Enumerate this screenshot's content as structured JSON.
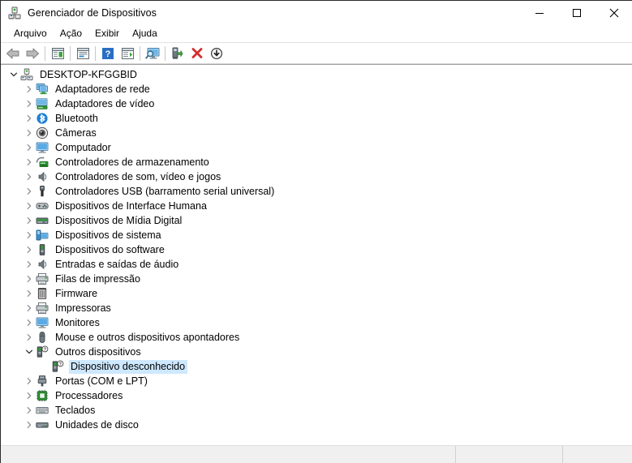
{
  "window": {
    "title": "Gerenciador de Dispositivos",
    "icon": "device-manager-icon",
    "minimize_label": "Minimizar",
    "maximize_label": "Maximizar",
    "close_label": "Fechar"
  },
  "menubar": {
    "items": [
      {
        "label": "Arquivo",
        "name": "menu-arquivo"
      },
      {
        "label": "Ação",
        "name": "menu-acao"
      },
      {
        "label": "Exibir",
        "name": "menu-exibir"
      },
      {
        "label": "Ajuda",
        "name": "menu-ajuda"
      }
    ]
  },
  "toolbar": {
    "buttons": [
      {
        "name": "back-button",
        "icon": "back-arrow-icon",
        "tooltip": "Voltar"
      },
      {
        "name": "forward-button",
        "icon": "forward-arrow-icon",
        "tooltip": "Avançar"
      },
      {
        "name": "separator-1",
        "icon": "separator",
        "tooltip": ""
      },
      {
        "name": "show-hide-console-tree-button",
        "icon": "console-tree-icon",
        "tooltip": "Mostrar/ocultar árvore do console"
      },
      {
        "name": "separator-2",
        "icon": "separator",
        "tooltip": ""
      },
      {
        "name": "properties-button",
        "icon": "properties-icon",
        "tooltip": "Propriedades"
      },
      {
        "name": "separator-3",
        "icon": "separator",
        "tooltip": ""
      },
      {
        "name": "help-button",
        "icon": "help-question-icon",
        "tooltip": "Ajuda"
      },
      {
        "name": "scan-hardware-changes-button",
        "icon": "scan-hardware-icon",
        "tooltip": "Verificar alterações de hardware"
      },
      {
        "name": "separator-4",
        "icon": "separator",
        "tooltip": ""
      },
      {
        "name": "show-hidden-devices-button",
        "icon": "monitor-search-icon",
        "tooltip": "Exibir dispositivos ocultos"
      },
      {
        "name": "separator-5",
        "icon": "separator",
        "tooltip": ""
      },
      {
        "name": "update-driver-button",
        "icon": "update-driver-icon",
        "tooltip": "Atualizar driver"
      },
      {
        "name": "uninstall-device-button",
        "icon": "red-x-icon",
        "tooltip": "Desinstalar dispositivo"
      },
      {
        "name": "disable-device-button",
        "icon": "disable-device-icon",
        "tooltip": "Desabilitar dispositivo"
      }
    ]
  },
  "tree": {
    "nodes": [
      {
        "label": "DESKTOP-KFGGBID",
        "level": 0,
        "state": "expanded",
        "icon": "computer-root-icon",
        "selected": false
      },
      {
        "label": "Adaptadores de rede",
        "level": 1,
        "state": "collapsed",
        "icon": "network-adapter-icon",
        "selected": false
      },
      {
        "label": "Adaptadores de vídeo",
        "level": 1,
        "state": "collapsed",
        "icon": "display-adapter-icon",
        "selected": false
      },
      {
        "label": "Bluetooth",
        "level": 1,
        "state": "collapsed",
        "icon": "bluetooth-icon",
        "selected": false
      },
      {
        "label": "Câmeras",
        "level": 1,
        "state": "collapsed",
        "icon": "camera-icon",
        "selected": false
      },
      {
        "label": "Computador",
        "level": 1,
        "state": "collapsed",
        "icon": "computer-icon",
        "selected": false
      },
      {
        "label": "Controladores de armazenamento",
        "level": 1,
        "state": "collapsed",
        "icon": "storage-controller-icon",
        "selected": false
      },
      {
        "label": "Controladores de som, vídeo e jogos",
        "level": 1,
        "state": "collapsed",
        "icon": "sound-icon",
        "selected": false
      },
      {
        "label": "Controladores USB (barramento serial universal)",
        "level": 1,
        "state": "collapsed",
        "icon": "usb-icon",
        "selected": false
      },
      {
        "label": "Dispositivos de Interface Humana",
        "level": 1,
        "state": "collapsed",
        "icon": "hid-gamepad-icon",
        "selected": false
      },
      {
        "label": "Dispositivos de Mídia Digital",
        "level": 1,
        "state": "collapsed",
        "icon": "digital-media-icon",
        "selected": false
      },
      {
        "label": "Dispositivos de sistema",
        "level": 1,
        "state": "collapsed",
        "icon": "system-device-icon",
        "selected": false
      },
      {
        "label": "Dispositivos do software",
        "level": 1,
        "state": "collapsed",
        "icon": "software-device-icon",
        "selected": false
      },
      {
        "label": "Entradas e saídas de áudio",
        "level": 1,
        "state": "collapsed",
        "icon": "audio-io-icon",
        "selected": false
      },
      {
        "label": "Filas de impressão",
        "level": 1,
        "state": "collapsed",
        "icon": "print-queue-icon",
        "selected": false
      },
      {
        "label": "Firmware",
        "level": 1,
        "state": "collapsed",
        "icon": "firmware-chip-icon",
        "selected": false
      },
      {
        "label": "Impressoras",
        "level": 1,
        "state": "collapsed",
        "icon": "printer-icon",
        "selected": false
      },
      {
        "label": "Monitores",
        "level": 1,
        "state": "collapsed",
        "icon": "monitor-icon",
        "selected": false
      },
      {
        "label": "Mouse e outros dispositivos apontadores",
        "level": 1,
        "state": "collapsed",
        "icon": "mouse-icon",
        "selected": false
      },
      {
        "label": "Outros dispositivos",
        "level": 1,
        "state": "expanded",
        "icon": "unknown-device-icon",
        "selected": false
      },
      {
        "label": "Dispositivo desconhecido",
        "level": 2,
        "state": "leaf",
        "icon": "unknown-device-icon",
        "selected": true
      },
      {
        "label": "Portas (COM e LPT)",
        "level": 1,
        "state": "collapsed",
        "icon": "port-icon",
        "selected": false
      },
      {
        "label": "Processadores",
        "level": 1,
        "state": "collapsed",
        "icon": "processor-icon",
        "selected": false
      },
      {
        "label": "Teclados",
        "level": 1,
        "state": "collapsed",
        "icon": "keyboard-icon",
        "selected": false
      },
      {
        "label": "Unidades de disco",
        "level": 1,
        "state": "collapsed",
        "icon": "disk-drive-icon",
        "selected": false
      }
    ]
  },
  "statusbar": {
    "cells": [
      {
        "name": "status-main-cell",
        "text": ""
      },
      {
        "name": "status-mid-cell",
        "text": ""
      },
      {
        "name": "status-end-cell",
        "text": ""
      }
    ]
  },
  "colors": {
    "selection_highlight": "#cde8ff",
    "window_background": "#ffffff",
    "statusbar_background": "#f0f0f0",
    "accent_blue": "#2a7fd4",
    "uninstall_red": "#d42d2d",
    "driver_green": "#3aa03a"
  }
}
